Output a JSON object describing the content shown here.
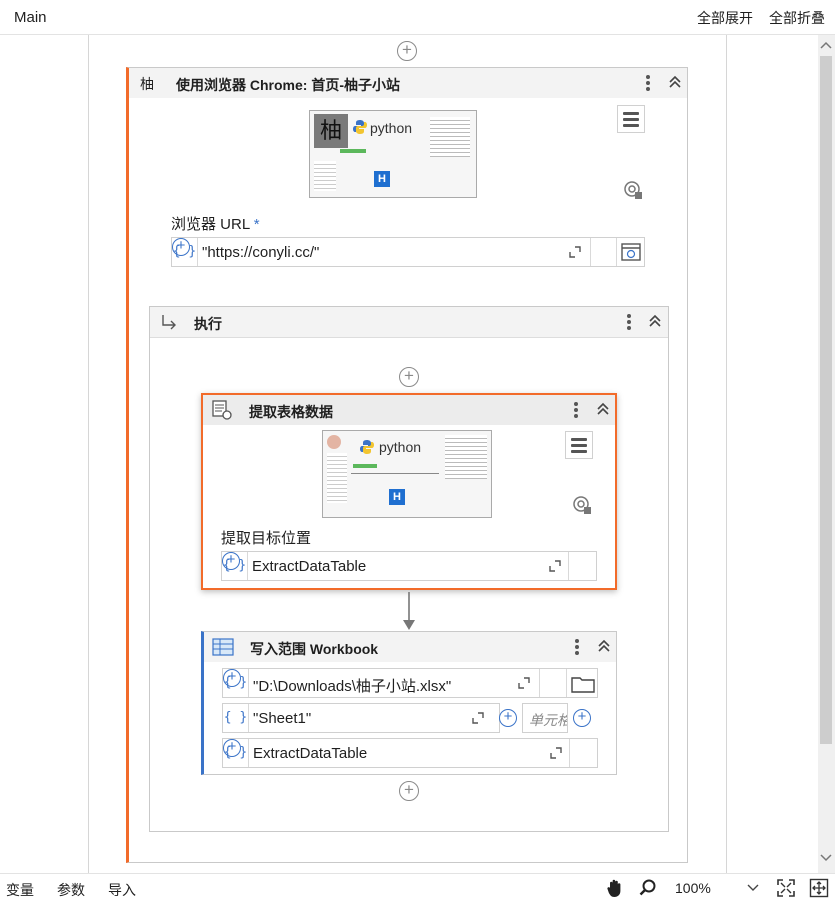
{
  "header": {
    "title": "Main",
    "expand_all": "全部展开",
    "collapse_all": "全部折叠"
  },
  "browser_activity": {
    "icon_glyph": "柚",
    "title": "使用浏览器 Chrome: 首页-柚子小站",
    "screenshot": {
      "python_text": "python",
      "badge": "H",
      "site_glyph": "柚"
    },
    "url_label": "浏览器 URL",
    "required_mark": "*",
    "url_value": "\"https://conyli.cc/\""
  },
  "do_block": {
    "title": "执行"
  },
  "extract_activity": {
    "title": "提取表格数据",
    "screenshot": {
      "python_text": "python",
      "badge": "H"
    },
    "target_label": "提取目标位置",
    "target_value": "ExtractDataTable"
  },
  "write_range": {
    "title": "写入范围 Workbook",
    "path_value": "\"D:\\Downloads\\柚子小站.xlsx\"",
    "sheet_value": "\"Sheet1\"",
    "cell_placeholder": "单元格",
    "data_value": "ExtractDataTable"
  },
  "brace_glyph": "{ }",
  "status_bar": {
    "variables": "变量",
    "arguments": "参数",
    "imports": "导入",
    "zoom": "100%"
  },
  "colors": {
    "accent_orange": "#f26b2a",
    "accent_blue": "#3a73c8",
    "selected_border": "#f26b2a"
  }
}
